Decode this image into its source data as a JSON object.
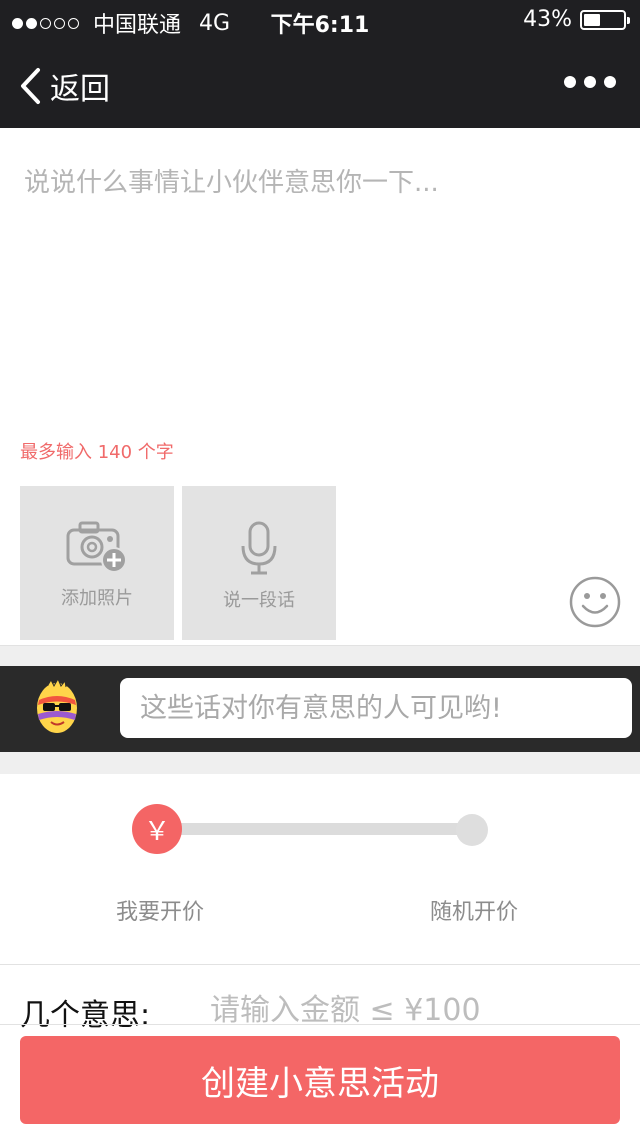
{
  "status_bar": {
    "carrier": "中国联通",
    "network": "4G",
    "time": "下午6:11",
    "battery_text": "43%",
    "battery_level": 0.43,
    "signal_bars_filled": 2,
    "signal_bars_total": 5
  },
  "nav": {
    "back_label": "返回",
    "back_icon": "chevron-left-icon",
    "more_icon": "more-dots-icon"
  },
  "composer": {
    "placeholder": "说说什么事情让小伙伴意思你一下...",
    "char_limit_note": "最多输入 140 个字"
  },
  "media": {
    "add_photo_label": "添加照片",
    "voice_label": "说一段话",
    "photo_icon": "camera-add-icon",
    "voice_icon": "microphone-icon",
    "emoji_icon": "smiley-icon"
  },
  "note": {
    "avatar_icon": "egg-mascot-icon",
    "placeholder": "这些话对你有意思的人可见哟!"
  },
  "pricing": {
    "knob_symbol": "￥",
    "option_mine": "我要开价",
    "option_random": "随机开价",
    "selected": "我要开价"
  },
  "amount": {
    "label": "几个意思:",
    "placeholder": "请输入金额 ≤ ¥100"
  },
  "actions": {
    "create_label": "创建小意思活动"
  },
  "colors": {
    "accent": "#f46666",
    "header_bg": "#1f1f22",
    "note_bar_bg": "#2a2a2a"
  }
}
